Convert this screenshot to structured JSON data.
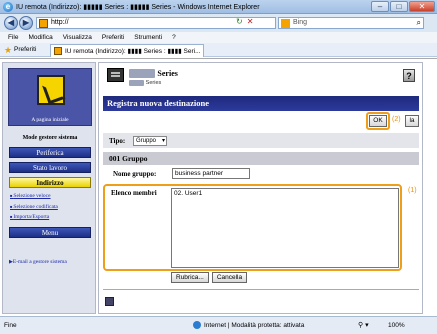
{
  "browser": {
    "title": "IU remota (Indirizzo): ▮▮▮▮▮ Series : ▮▮▮▮▮ Series - Windows Internet Explorer",
    "url": "http://",
    "search_placeholder": "Bing",
    "menu": [
      "File",
      "Modifica",
      "Visualizza",
      "Preferiti",
      "Strumenti",
      "?"
    ],
    "favorites_label": "Preferiti",
    "tab_title": "IU remota (Indirizzo): ▮▮▮▮ Series : ▮▮▮▮ Seri..."
  },
  "sidebar": {
    "home_label": "A pagina iniziale",
    "mode_label": "Mode gestore sistema",
    "buttons": [
      "Periferica",
      "Stato lavoro",
      "Indirizzo"
    ],
    "active_button": "Indirizzo",
    "links": [
      "Selezione veloce",
      "Selezione codificata",
      "Importa/Esporta"
    ],
    "menu_button": "Menu",
    "email_link": "E-mail a gestore sistema"
  },
  "header": {
    "series_title": "Series",
    "series_sub": "Series",
    "help_icon": "?"
  },
  "main": {
    "page_title": "Registra nuova destinazione",
    "ok_label": "OK",
    "other_button": "la",
    "annotation_ok": "(2)",
    "annotation_members": "(1)",
    "type_label": "Tipo:",
    "type_value": "Gruppo",
    "group_header": "001 Gruppo",
    "group_name_label": "Nome gruppo:",
    "group_name_value": "business partner",
    "members_label": "Elenco membri",
    "members": [
      "02. User1"
    ],
    "address_book_button": "Rubrica...",
    "delete_button": "Cancella"
  },
  "status": {
    "left": "Fine",
    "zone": "Internet | Modalità protetta: attivata",
    "zoom": "100%"
  }
}
